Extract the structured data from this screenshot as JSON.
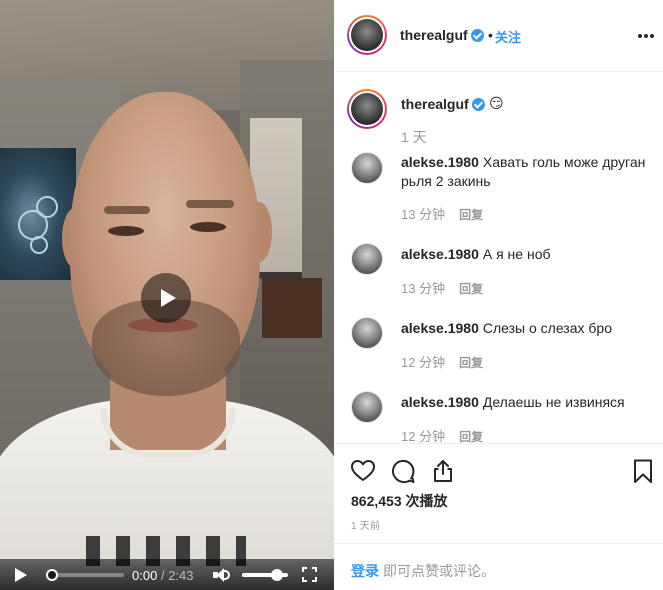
{
  "post": {
    "username": "therealguf",
    "verified": true,
    "follow_dot": "•",
    "follow_label": "关注",
    "more_icon": "more-horizontal-icon",
    "caption_emoji": "😏",
    "caption_time": "1 天"
  },
  "comments": [
    {
      "username": "alekse.1980",
      "text": "Хавать голь може друган рьля 2 закинь",
      "time": "13 分钟",
      "reply_label": "回复"
    },
    {
      "username": "alekse.1980",
      "text": "А я не ноб",
      "time": "13 分钟",
      "reply_label": "回复"
    },
    {
      "username": "alekse.1980",
      "text": "Слезы о слезах бро",
      "time": "12 分钟",
      "reply_label": "回复"
    },
    {
      "username": "alekse.1980",
      "text": "Делаешь не извиняся",
      "time": "12 分钟",
      "reply_label": "回复"
    }
  ],
  "video": {
    "current_time": "0:00",
    "separator": "/",
    "total_time": "2:43",
    "progress": 0,
    "volume": 0.85
  },
  "actions": {
    "icons": [
      "heart-icon",
      "comment-icon",
      "share-icon",
      "bookmark-icon"
    ],
    "views": "862,453 次播放",
    "post_time": "1 天前"
  },
  "login": {
    "link": "登录",
    "rest": " 即可点赞或评论。"
  },
  "colors": {
    "accent": "#3897f0",
    "text": "#262626",
    "muted": "#999999",
    "border": "#efefef"
  }
}
